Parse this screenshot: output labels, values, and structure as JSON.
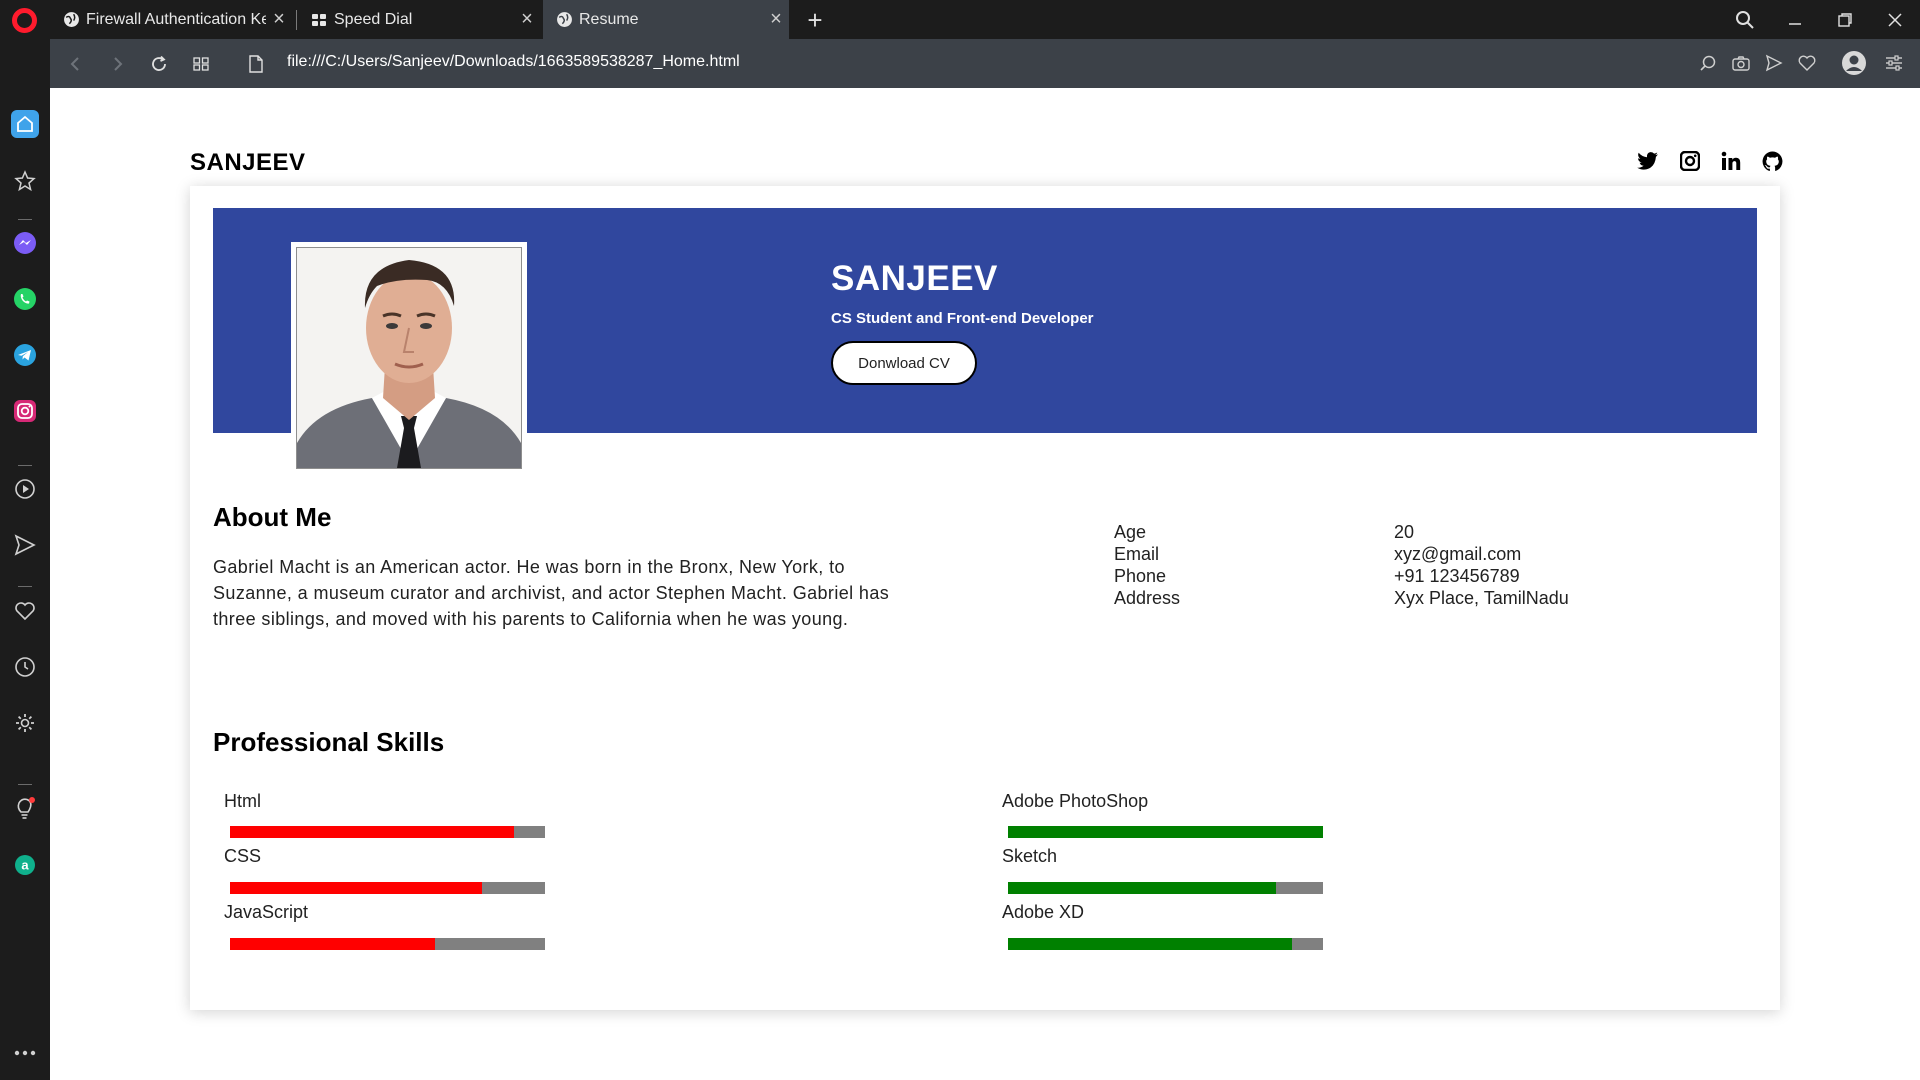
{
  "browser": {
    "tabs": [
      {
        "title": "Firewall Authentication Kee",
        "active": false
      },
      {
        "title": "Speed Dial",
        "active": false
      },
      {
        "title": "Resume",
        "active": true
      }
    ],
    "url": "file:///C:/Users/Sanjeev/Downloads/1663589538287_Home.html"
  },
  "site": {
    "brand": "SANJEEV",
    "social": [
      "twitter-icon",
      "instagram-icon",
      "linkedin-icon",
      "github-icon"
    ]
  },
  "hero": {
    "name": "SANJEEV",
    "role": "CS Student and Front-end Developer",
    "cv_button": "Donwload CV",
    "banner_color": "#30479e"
  },
  "about": {
    "title": "About Me",
    "text": "Gabriel Macht is an American actor. He was born in the Bronx, New York, to Suzanne, a museum curator and archivist, and actor Stephen Macht. Gabriel has three siblings, and moved with his parents to California when he was young."
  },
  "info": [
    {
      "key": "Age",
      "value": "20"
    },
    {
      "key": "Email",
      "value": "xyz@gmail.com"
    },
    {
      "key": "Phone",
      "value": "+91 123456789"
    },
    {
      "key": "Address",
      "value": "Xyx Place, TamilNadu"
    }
  ],
  "skills": {
    "title": "Professional Skills",
    "left": [
      {
        "name": "Html",
        "level": 0.9,
        "color": "#ff0000"
      },
      {
        "name": "CSS",
        "level": 0.8,
        "color": "#ff0000"
      },
      {
        "name": "JavaScript",
        "level": 0.65,
        "color": "#ff0000"
      }
    ],
    "right": [
      {
        "name": "Adobe PhotoShop",
        "level": 1.0,
        "color": "#008000"
      },
      {
        "name": "Sketch",
        "level": 0.85,
        "color": "#008000"
      },
      {
        "name": "Adobe XD",
        "level": 0.9,
        "color": "#008000"
      }
    ]
  }
}
